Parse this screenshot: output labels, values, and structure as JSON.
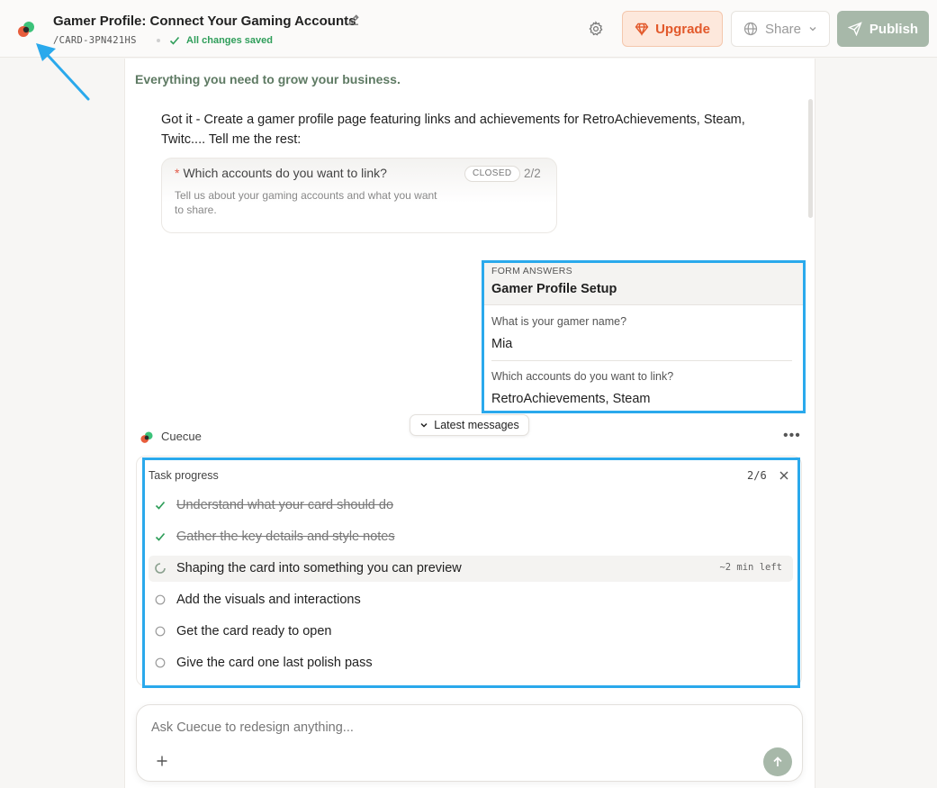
{
  "header": {
    "title": "Gamer Profile: Connect Your Gaming Accounts",
    "card_id": "/CARD-3PN421HS",
    "save_status": "All changes saved",
    "upgrade_label": "Upgrade",
    "share_label": "Share",
    "publish_label": "Publish"
  },
  "chat": {
    "tagline": "Everything you need to grow your business.",
    "assistant_message": "Got it - Create a gamer profile page featuring links and achievements for RetroAchievements, Steam, Twitc.... Tell me the rest:",
    "question_card": {
      "required_mark": "*",
      "title": "Which accounts do you want to link?",
      "badge": "CLOSED",
      "count": "2/2",
      "description": "Tell us about your gaming accounts and what you want to share."
    },
    "form_answers": {
      "kicker": "FORM ANSWERS",
      "title": "Gamer Profile Setup",
      "items": [
        {
          "question": "What is your gamer name?",
          "answer": "Mia"
        },
        {
          "question": "Which accounts do you want to link?",
          "answer": "RetroAchievements, Steam"
        }
      ]
    },
    "latest_messages_label": "Latest messages",
    "agent_name": "Cuecue",
    "more_label": "•••"
  },
  "task_progress": {
    "title": "Task progress",
    "count": "2/6",
    "steps": [
      {
        "label": "Understand what your card should do",
        "status": "done"
      },
      {
        "label": "Gather the key details and style notes",
        "status": "done"
      },
      {
        "label": "Shaping the card into something you can preview",
        "status": "in-progress",
        "eta": "~2 min left"
      },
      {
        "label": "Add the visuals and interactions",
        "status": "pending"
      },
      {
        "label": "Get the card ready to open",
        "status": "pending"
      },
      {
        "label": "Give the card one last polish pass",
        "status": "pending"
      }
    ]
  },
  "composer": {
    "placeholder": "Ask Cuecue to redesign anything..."
  },
  "colors": {
    "accent_green": "#2f9e5a",
    "upgrade_orange": "#e2592b",
    "publish_bg": "#a7b8a9",
    "highlight_blue": "#2aa9ec"
  },
  "icons": [
    "app-logo-icon",
    "pencil-icon",
    "check-icon",
    "gear-icon",
    "gem-icon",
    "globe-icon",
    "chevron-down-icon",
    "send-icon",
    "close-icon",
    "spinner-icon",
    "circle-icon",
    "plus-icon",
    "arrow-up-icon"
  ]
}
